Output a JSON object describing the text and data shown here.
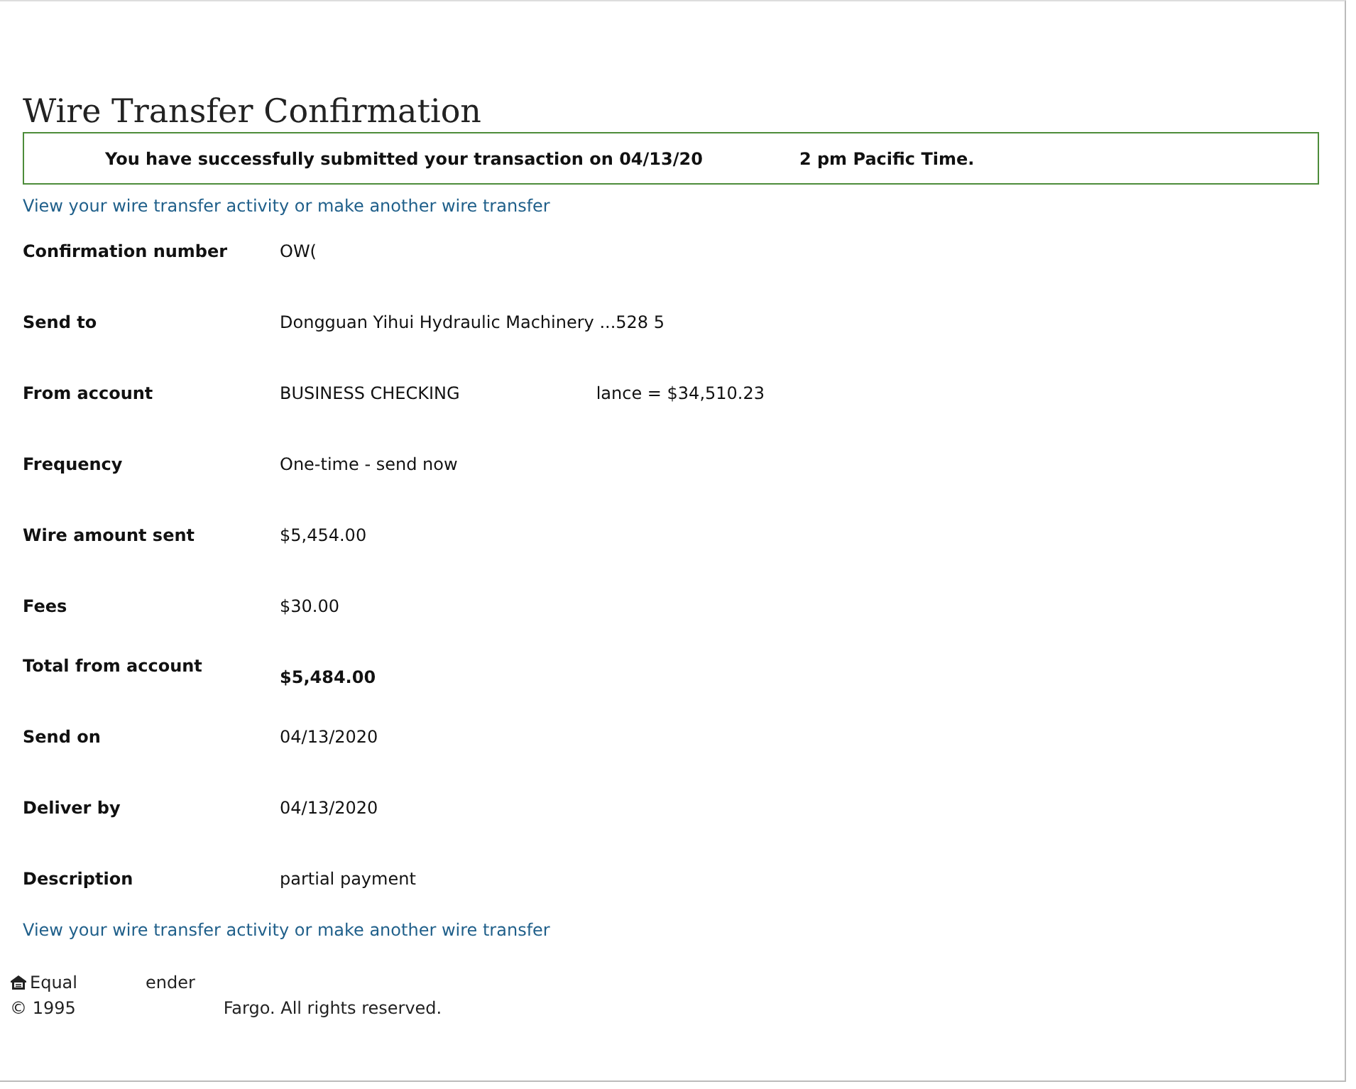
{
  "title": "Wire Transfer Confirmation",
  "notice": {
    "parts": [
      "You have successfully submitted your transaction on 04/13/20",
      "2 pm Pacific Time."
    ]
  },
  "top_link": "View your wire transfer activity or make another wire transfer",
  "details": [
    {
      "label": "Confirmation number",
      "values": [
        "OW("
      ],
      "bold": false
    },
    {
      "label": "Send to",
      "values": [
        "Dongguan Yihui Hydraulic Machinery ...528 5"
      ],
      "bold": false
    },
    {
      "label": "From account",
      "values": [
        "BUSINESS CHECKING",
        "lance = $34,510.23"
      ],
      "bold": false
    },
    {
      "label": "Frequency",
      "values": [
        "One-time - send now"
      ],
      "bold": false
    },
    {
      "label": "Wire amount sent",
      "values": [
        "$5,454.00"
      ],
      "bold": false
    },
    {
      "label": "Fees",
      "values": [
        "$30.00"
      ],
      "bold": false
    },
    {
      "label": "Total from account",
      "values": [
        "$5,484.00"
      ],
      "bold": true
    },
    {
      "label": "Send on",
      "values": [
        "04/13/2020"
      ],
      "bold": false
    },
    {
      "label": "Deliver by",
      "values": [
        "04/13/2020"
      ],
      "bold": false
    },
    {
      "label": "Description",
      "values": [
        "partial payment"
      ],
      "bold": false
    }
  ],
  "bottom_link": "View your wire transfer activity or make another wire transfer",
  "footer": {
    "lender": [
      "Equal",
      "ender"
    ],
    "copyright": [
      "© 1995",
      "Fargo. All rights reserved."
    ]
  }
}
